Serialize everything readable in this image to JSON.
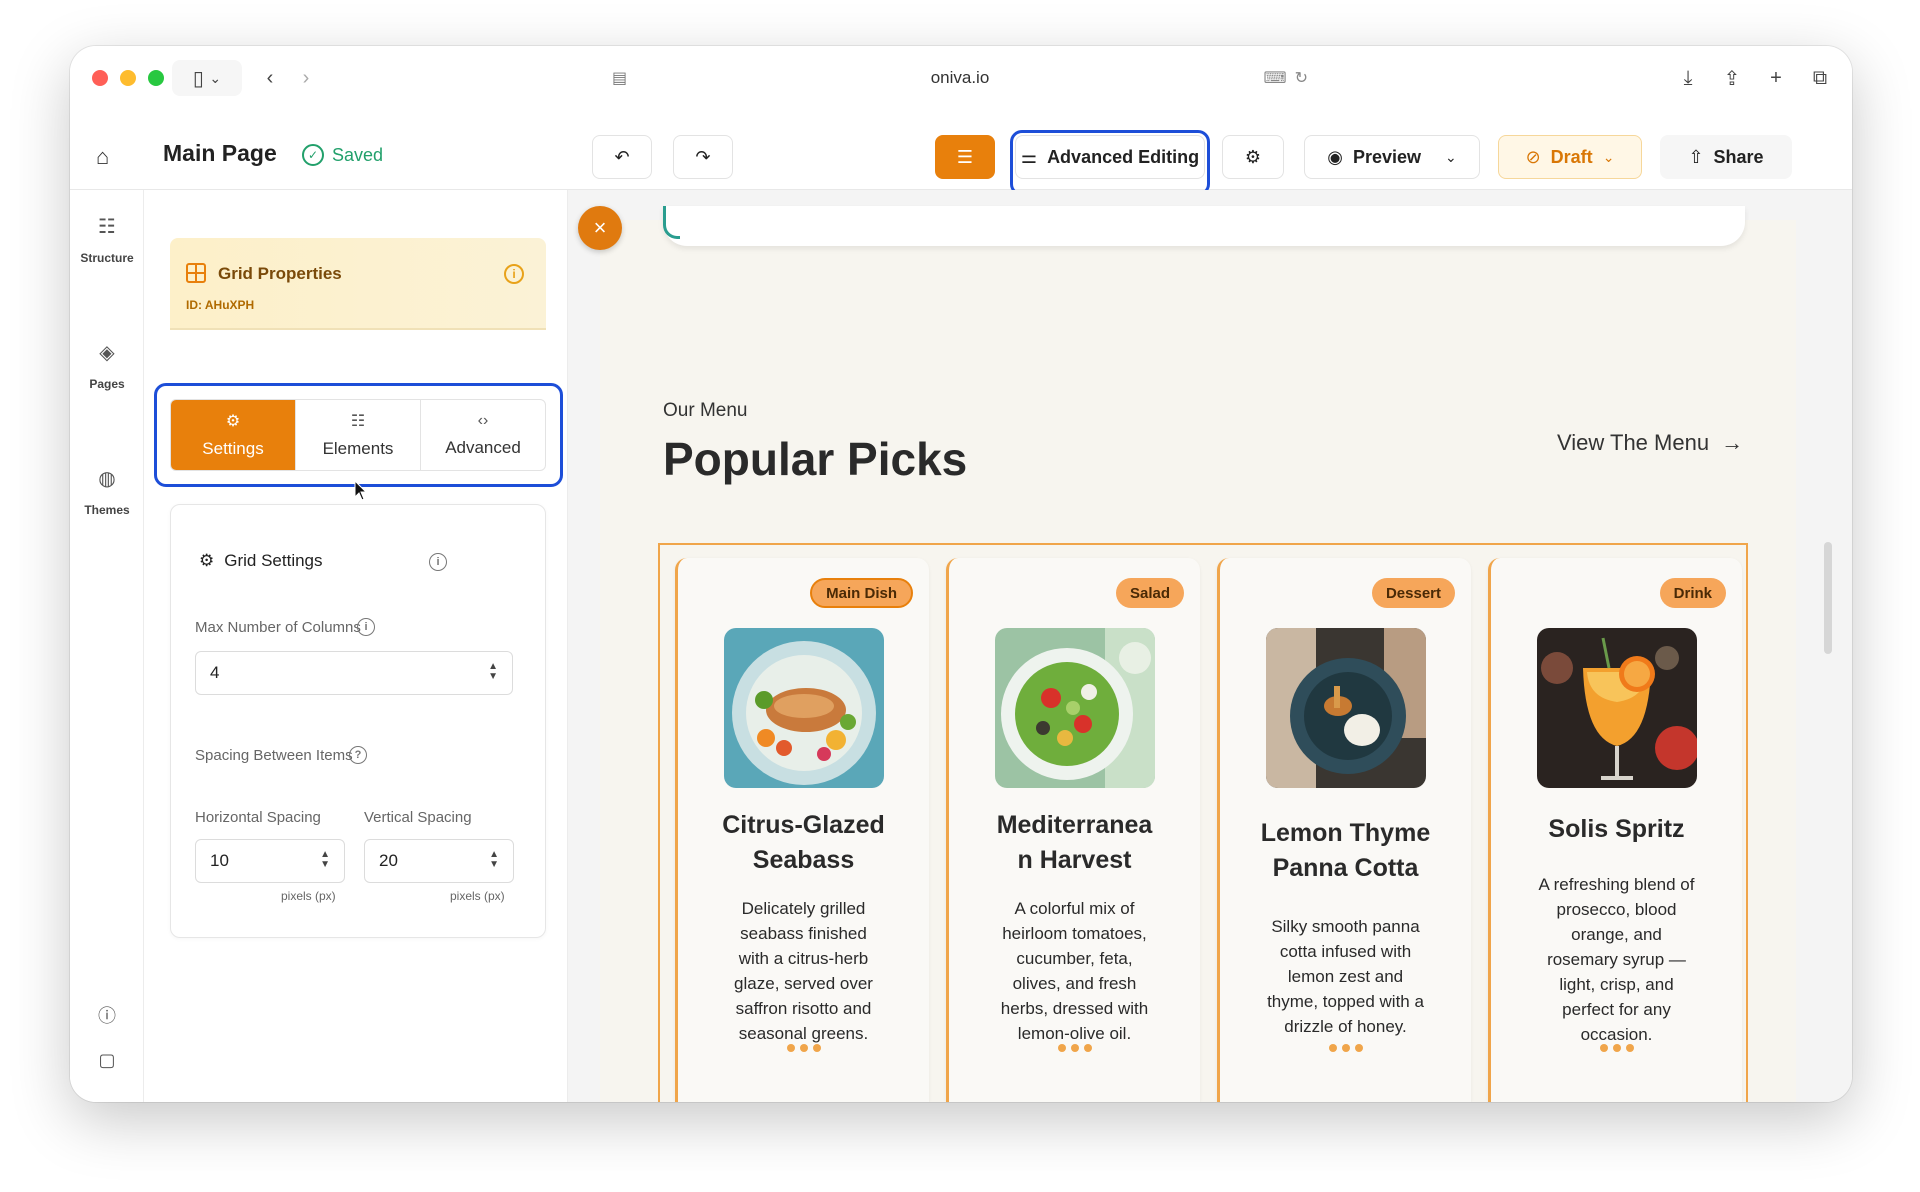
{
  "browser": {
    "url": "oniva.io",
    "traffic_colors": [
      "#ff5f57",
      "#febc2e",
      "#28c840"
    ]
  },
  "header": {
    "page_title": "Main Page",
    "saved_label": "Saved",
    "advanced_editing_label": "Advanced Editing",
    "preview_label": "Preview",
    "draft_label": "Draft",
    "share_label": "Share"
  },
  "rail": {
    "items": [
      {
        "label": "Structure",
        "icon": "structure-icon"
      },
      {
        "label": "Pages",
        "icon": "layers-icon"
      },
      {
        "label": "Themes",
        "icon": "palette-icon"
      }
    ]
  },
  "panel": {
    "title": "Grid Properties",
    "id_label": "ID: AHuXPH",
    "tabs": [
      {
        "label": "Settings",
        "icon": "gear-icon",
        "active": true
      },
      {
        "label": "Elements",
        "icon": "list-icon",
        "active": false
      },
      {
        "label": "Advanced",
        "icon": "code-icon",
        "active": false
      }
    ],
    "grid_settings_title": "Grid Settings",
    "max_columns_label": "Max Number of Columns",
    "max_columns_value": "4",
    "spacing_label": "Spacing Between Items",
    "horizontal_label": "Horizontal Spacing",
    "horizontal_value": "10",
    "vertical_label": "Vertical Spacing",
    "vertical_value": "20",
    "unit_label": "pixels (px)"
  },
  "canvas": {
    "eyebrow": "Our Menu",
    "heading": "Popular Picks",
    "view_menu": "View The Menu",
    "cards": [
      {
        "badge": "Main Dish",
        "title_l1": "Citrus-Glazed",
        "title_l2": "Seabass",
        "desc": [
          "Delicately grilled",
          "seabass finished",
          "with a citrus-herb",
          "glaze, served over",
          "saffron risotto and",
          "seasonal greens."
        ]
      },
      {
        "badge": "Salad",
        "title_l1": "Mediterranea",
        "title_l2": "n Harvest",
        "desc": [
          "A colorful mix of",
          "heirloom tomatoes,",
          "cucumber, feta,",
          "olives, and fresh",
          "herbs, dressed with",
          "lemon-olive oil."
        ]
      },
      {
        "badge": "Dessert",
        "title_l1": "Lemon Thyme",
        "title_l2": "Panna Cotta",
        "desc": [
          "Silky smooth panna",
          "cotta infused with",
          "lemon zest and",
          "thyme, topped with a",
          "drizzle of honey."
        ]
      },
      {
        "badge": "Drink",
        "title_l1": "Solis Spritz",
        "title_l2": "",
        "desc": [
          "A refreshing blend of",
          "prosecco, blood",
          "orange, and",
          "rosemary syrup —",
          "light, crisp, and",
          "perfect for any",
          "occasion."
        ]
      }
    ]
  },
  "colors": {
    "accent": "#e8800c",
    "highlight": "#1d4ed8",
    "saved": "#22a06b"
  }
}
